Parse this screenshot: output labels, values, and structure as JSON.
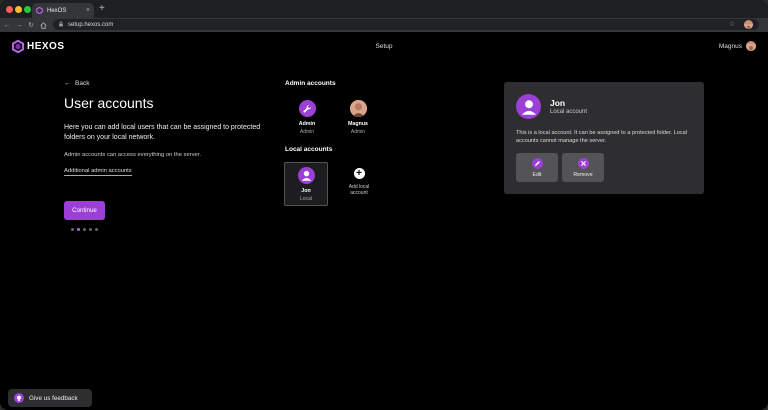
{
  "browser": {
    "tab_title": "HexOS",
    "url": "setup.hexos.com"
  },
  "header": {
    "logo_text": "HEXOS",
    "title": "Setup",
    "user_name": "Magnus"
  },
  "left": {
    "back_label": "Back",
    "title": "User accounts",
    "intro": "Here you can add local users that can be assigned to protected folders on your local network.",
    "admin_note": "Admin accounts can access everything on the server.",
    "admin_link": "Additional admin accounts",
    "continue_label": "Continue",
    "steps_total": 5,
    "steps_current": 2
  },
  "admin_accounts": {
    "title": "Admin accounts",
    "items": [
      {
        "name": "Admin",
        "role": "Admin"
      },
      {
        "name": "Magnus",
        "role": "Admin"
      }
    ]
  },
  "local_accounts": {
    "title": "Local accounts",
    "items": [
      {
        "name": "Jon",
        "role": "Local"
      }
    ],
    "add_label_line1": "Add local",
    "add_label_line2": "account"
  },
  "detail": {
    "name": "Jon",
    "type": "Local account",
    "description": "This is a local account. It can be assigned to a protected folder. Local accounts cannot manage the server.",
    "edit_label": "Edit",
    "remove_label": "Remove"
  },
  "feedback": {
    "label": "Give us feedback"
  },
  "colors": {
    "accent": "#9b3fd6",
    "background": "#000000",
    "panel": "#2e2e30"
  }
}
